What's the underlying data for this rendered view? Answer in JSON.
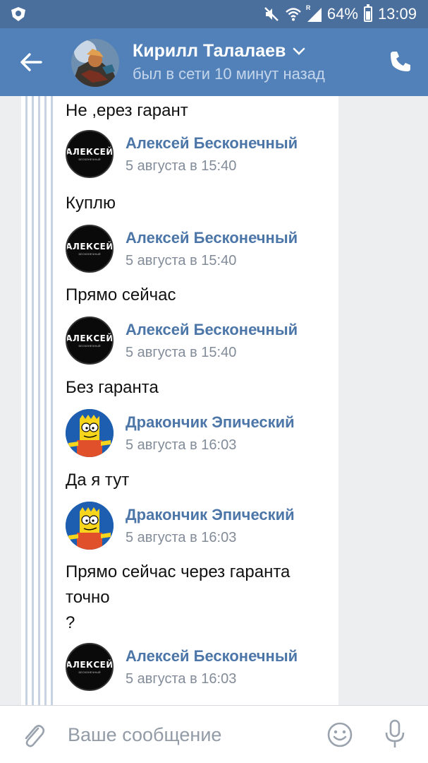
{
  "statusbar": {
    "battery_percent": "64%",
    "time": "13:09",
    "signal_label": "R",
    "battery_level": 0.64
  },
  "header": {
    "name": "Кирилл Талалаев",
    "status": "был в сети 10 минут назад"
  },
  "messages": [
    {
      "text": "Не ,ерез гарант"
    },
    {
      "author": "Алексей Бесконечный",
      "time": "5 августа в 15:40",
      "avatar": "alexei",
      "text": "Куплю"
    },
    {
      "author": "Алексей Бесконечный",
      "time": "5 августа в 15:40",
      "avatar": "alexei",
      "text": "Прямо сейчас"
    },
    {
      "author": "Алексей Бесконечный",
      "time": "5 августа в 15:40",
      "avatar": "alexei",
      "text": "Без гаранта"
    },
    {
      "author": "Дракончик Эпический",
      "time": "5 августа в 16:03",
      "avatar": "bart",
      "text": "Да я тут"
    },
    {
      "author": "Дракончик Эпический",
      "time": "5 августа в 16:03",
      "avatar": "bart",
      "text": "Прямо сейчас через гаранта\nточно\n?"
    },
    {
      "author": "Алексей Бесконечный",
      "time": "5 августа в 16:03",
      "avatar": "alexei"
    }
  ],
  "avatar_logo": {
    "big": "АЛЕКСЕЙ",
    "small": "БЕСКОНЕЧНЫЙ"
  },
  "input": {
    "placeholder": "Ваше сообщение"
  },
  "colors": {
    "statusbar": "#4a6f9c",
    "header": "#5181b8",
    "link": "#4c76a8",
    "meta": "#828c99"
  },
  "icons": [
    "shield-icon",
    "mute-icon",
    "wifi-icon",
    "signal-icon",
    "battery-icon",
    "back-arrow-icon",
    "chevron-down-icon",
    "phone-icon",
    "paperclip-icon",
    "smiley-icon",
    "microphone-icon"
  ]
}
